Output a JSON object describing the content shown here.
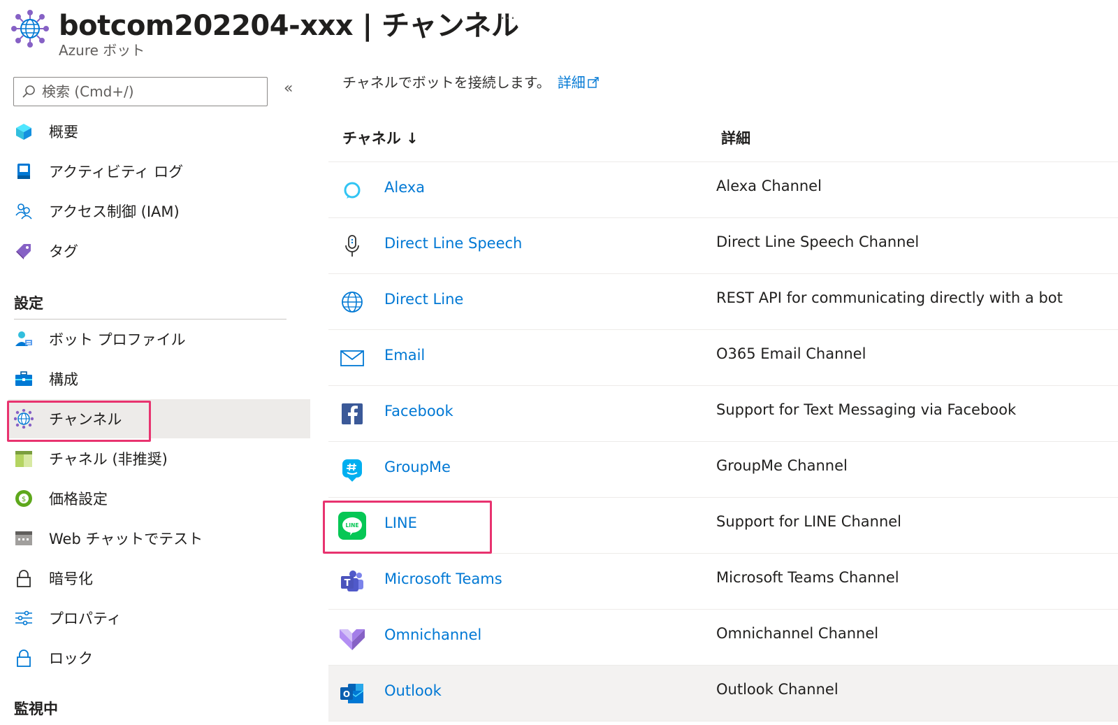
{
  "header": {
    "title": "botcom202204-xxx | チャンネル",
    "more": "···",
    "subtitle": "Azure ボット"
  },
  "search": {
    "placeholder": "検索 (Cmd+/)",
    "collapse": "«"
  },
  "sidebar": {
    "items": [
      {
        "label": "概要",
        "icon": "cube-icon"
      },
      {
        "label": "アクティビティ ログ",
        "icon": "activity-log-icon"
      },
      {
        "label": "アクセス制御 (IAM)",
        "icon": "people-icon"
      },
      {
        "label": "タグ",
        "icon": "tag-icon"
      }
    ],
    "section_settings": "設定",
    "settings_items": [
      {
        "label": "ボット プロファイル",
        "icon": "bot-profile-icon"
      },
      {
        "label": "構成",
        "icon": "toolbox-icon"
      },
      {
        "label": "チャンネル",
        "icon": "globe-network-icon",
        "active": true
      },
      {
        "label": "チャネル (非推奨)",
        "icon": "deprecated-channel-icon"
      },
      {
        "label": "価格設定",
        "icon": "pricing-icon"
      },
      {
        "label": "Web チャットでテスト",
        "icon": "webchat-icon"
      },
      {
        "label": "暗号化",
        "icon": "lock-icon"
      },
      {
        "label": "プロパティ",
        "icon": "sliders-icon"
      },
      {
        "label": "ロック",
        "icon": "lock-icon"
      }
    ],
    "section_monitor": "監視中"
  },
  "main": {
    "intro": "チャネルでボットを接続します。",
    "intro_link": "詳細",
    "col_channel": "チャネル ↓",
    "col_detail": "詳細",
    "rows": [
      {
        "name": "Alexa",
        "desc": "Alexa Channel",
        "icon": "alexa-icon"
      },
      {
        "name": "Direct Line Speech",
        "desc": "Direct Line Speech Channel",
        "icon": "microphone-icon"
      },
      {
        "name": "Direct Line",
        "desc": "REST API for communicating directly with a bot",
        "icon": "globe-icon"
      },
      {
        "name": "Email",
        "desc": "O365 Email Channel",
        "icon": "email-icon"
      },
      {
        "name": "Facebook",
        "desc": "Support for Text Messaging via Facebook",
        "icon": "facebook-icon"
      },
      {
        "name": "GroupMe",
        "desc": "GroupMe Channel",
        "icon": "groupme-icon"
      },
      {
        "name": "LINE",
        "desc": "Support for LINE Channel",
        "icon": "line-icon",
        "icon_text": "LINE"
      },
      {
        "name": "Microsoft Teams",
        "desc": "Microsoft Teams Channel",
        "icon": "teams-icon"
      },
      {
        "name": "Omnichannel",
        "desc": "Omnichannel Channel",
        "icon": "omnichannel-icon"
      },
      {
        "name": "Outlook",
        "desc": "Outlook Channel",
        "icon": "outlook-icon"
      }
    ]
  },
  "colors": {
    "link": "#0078d4",
    "highlight": "#e8336f",
    "active_bg": "#edebe9",
    "line_green": "#06c755"
  }
}
